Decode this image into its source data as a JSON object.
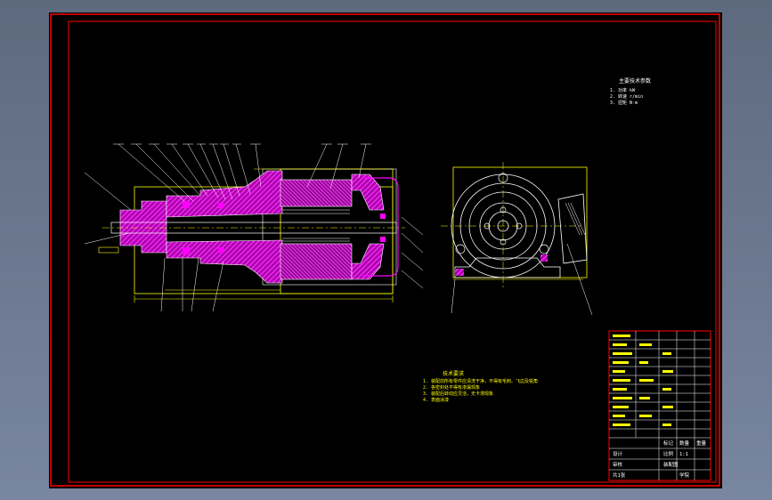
{
  "drawing": {
    "notes_heading": "主要技术参数",
    "notes_lines": [
      "1. 功率 kW",
      "2. 转速 r/min",
      "3. 扭矩 N·m"
    ],
    "tech_req_heading": "技术要求",
    "tech_req_lines": [
      "1. 装配前所有零件应清洗干净，不得有毛刺、飞边及锐角",
      "2. 各密封处不得有渗漏现象",
      "3. 装配后转动应灵活，无卡滞现象",
      "4. 表面涂漆"
    ],
    "title_block": {
      "scale": "1:1",
      "sheet": "共1张",
      "designer": "设计",
      "checker": "审核",
      "label_mark": "标记",
      "label_qty": "数量",
      "label_weight": "重量",
      "label_ratio": "比例",
      "school": "学院",
      "drawing_name": "装配图"
    }
  },
  "colors": {
    "frame": "#ff0000",
    "line": "#ffff00",
    "hatch": "#ff00ff",
    "inner": "#ffffff"
  }
}
